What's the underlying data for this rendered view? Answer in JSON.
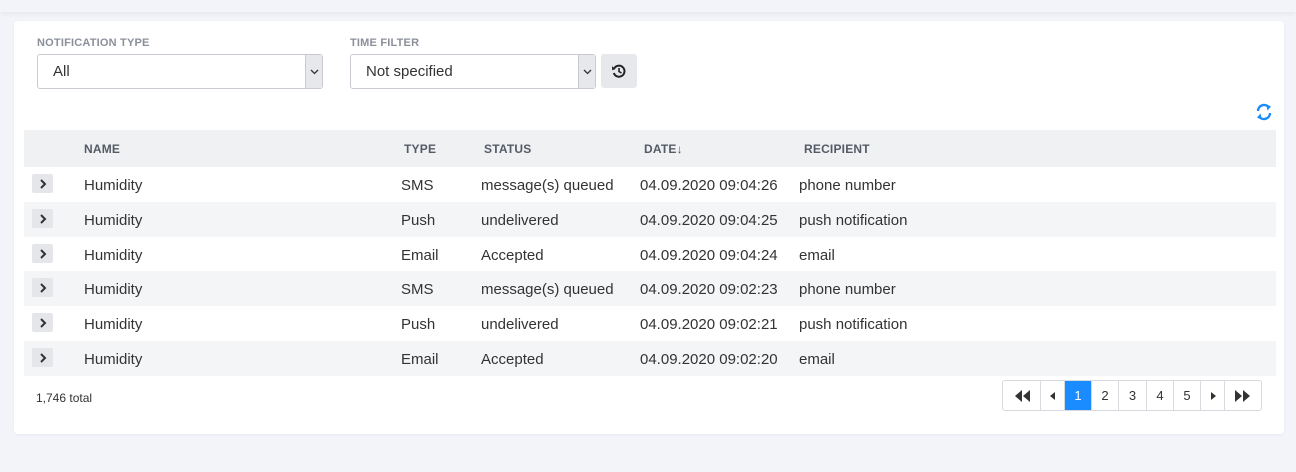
{
  "filters": {
    "notification_type": {
      "label": "NOTIFICATION TYPE",
      "value": "All"
    },
    "time_filter": {
      "label": "TIME FILTER",
      "value": "Not specified"
    }
  },
  "icons": {
    "reset": "history-icon",
    "refresh": "refresh-icon",
    "expand": "chevron-right-icon"
  },
  "colors": {
    "accent": "#1a8cff"
  },
  "table": {
    "columns": [
      "NAME",
      "TYPE",
      "STATUS",
      "DATE↓",
      "RECIPIENT"
    ],
    "rows": [
      {
        "name": "Humidity",
        "type": "SMS",
        "status": "message(s) queued",
        "date": "04.09.2020 09:04:26",
        "recipient": "phone number"
      },
      {
        "name": "Humidity",
        "type": "Push",
        "status": "undelivered",
        "date": "04.09.2020 09:04:25",
        "recipient": "push notification"
      },
      {
        "name": "Humidity",
        "type": "Email",
        "status": "Accepted",
        "date": "04.09.2020 09:04:24",
        "recipient": "email"
      },
      {
        "name": "Humidity",
        "type": "SMS",
        "status": "message(s) queued",
        "date": "04.09.2020 09:02:23",
        "recipient": "phone number"
      },
      {
        "name": "Humidity",
        "type": "Push",
        "status": "undelivered",
        "date": "04.09.2020 09:02:21",
        "recipient": "push notification"
      },
      {
        "name": "Humidity",
        "type": "Email",
        "status": "Accepted",
        "date": "04.09.2020 09:02:20",
        "recipient": "email"
      }
    ]
  },
  "footer": {
    "total": "1,746 total"
  },
  "pagination": {
    "pages": [
      "1",
      "2",
      "3",
      "4",
      "5"
    ],
    "current": "1"
  }
}
